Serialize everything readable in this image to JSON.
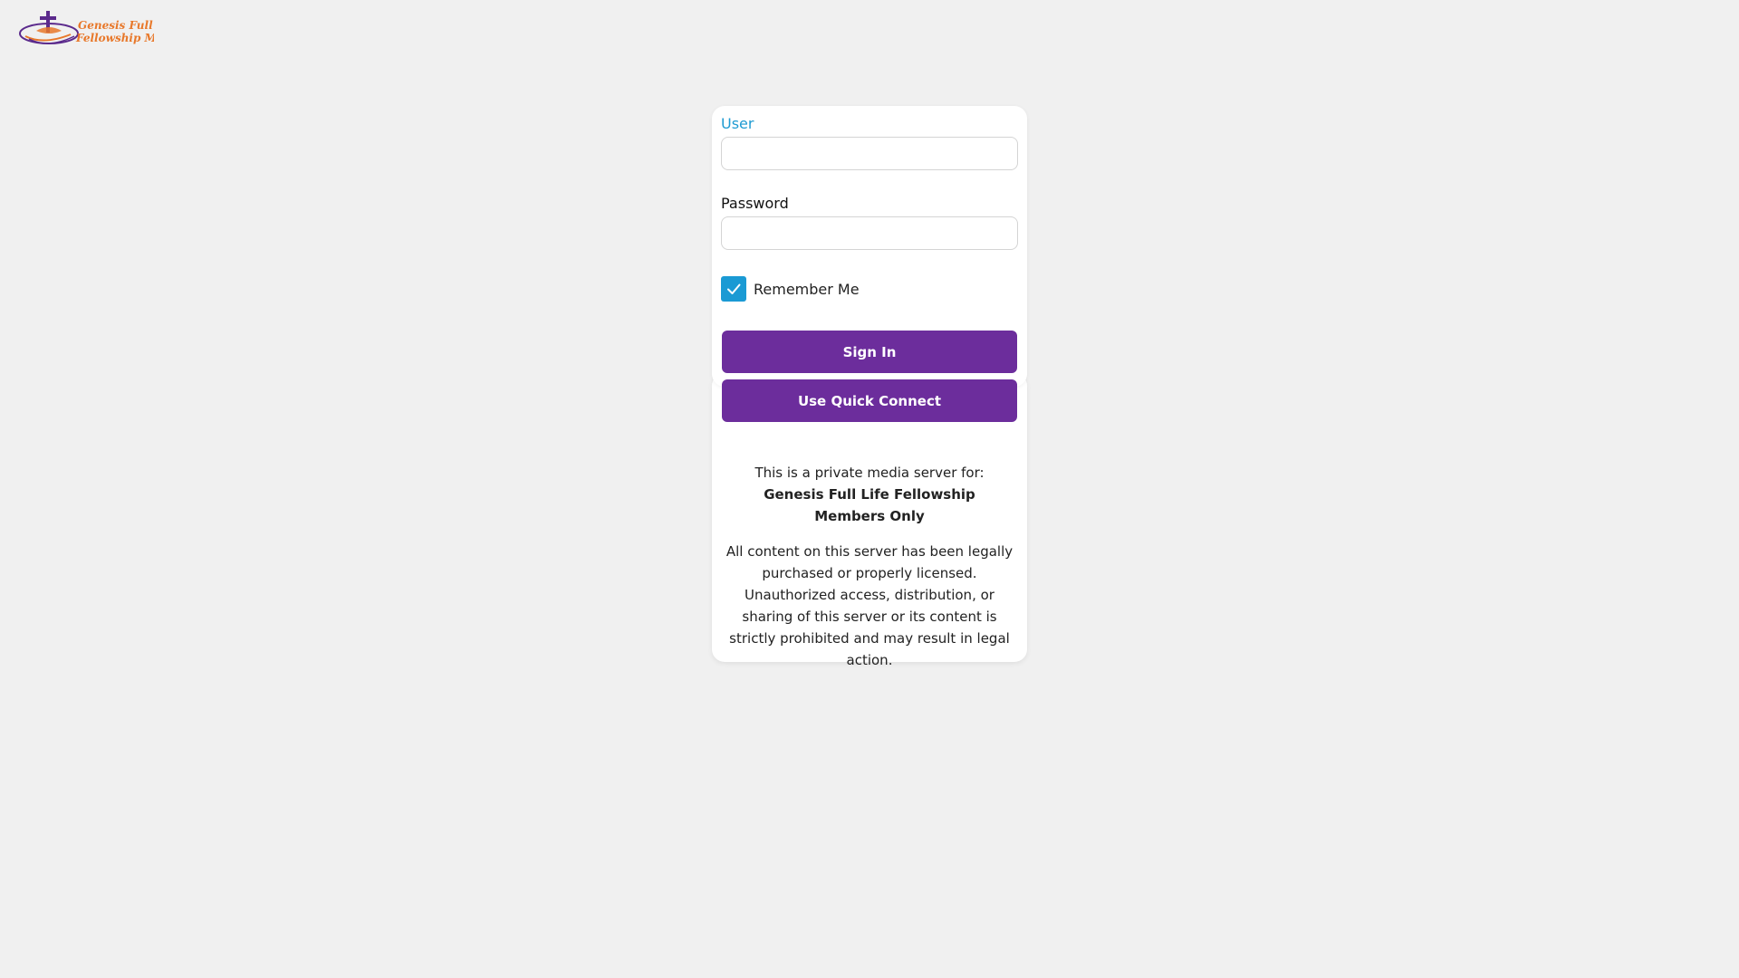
{
  "brand": {
    "logo_line1": "Genesis Full Life",
    "logo_line2": "Fellowship Media",
    "colors": {
      "logo_purple": "#5b2a8c",
      "logo_orange": "#e8782a"
    }
  },
  "login": {
    "user_label": "User",
    "user_value": "",
    "password_label": "Password",
    "password_value": "",
    "remember_me_label": "Remember Me",
    "remember_me_checked": true,
    "sign_in_label": "Sign In",
    "quick_connect_label": "Use Quick Connect"
  },
  "disclaimer": {
    "intro": "This is a private media server for:",
    "org_name": "Genesis Full Life Fellowship",
    "audience": "Members Only",
    "notice": "All content on this server has been legally purchased or properly licensed. Unauthorized access, distribution, or sharing of this server or its content is strictly prohibited and may result in legal action."
  },
  "colors": {
    "accent_blue": "#1a9ad4",
    "button_purple": "#6c2d9c",
    "background": "#f0f0f0",
    "card": "#ffffff"
  }
}
